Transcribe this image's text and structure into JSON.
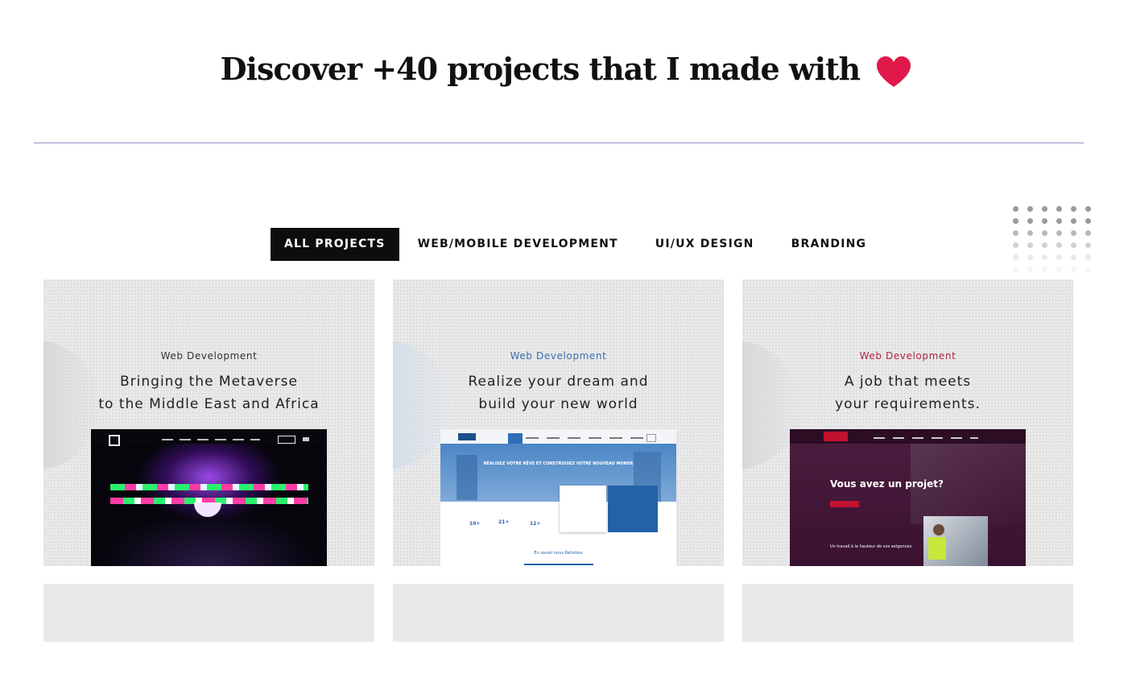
{
  "header": {
    "title": "Discover +40 projects that I made with",
    "heart_icon": "heart-icon",
    "heart_color": "#e0194a"
  },
  "filters": {
    "tabs": [
      {
        "label": "ALL PROJECTS",
        "active": true
      },
      {
        "label": "WEB/MOBILE DEVELOPMENT",
        "active": false
      },
      {
        "label": "UI/UX DESIGN",
        "active": false
      },
      {
        "label": "BRANDING",
        "active": false
      }
    ]
  },
  "projects": [
    {
      "category": "Web Development",
      "category_color": "#333333",
      "title_line1": "Bringing the Metaverse",
      "title_line2": "to the Middle East and Africa"
    },
    {
      "category": "Web Development",
      "category_color": "#3b6db0",
      "title_line1": "Realize your dream and",
      "title_line2": "build your new world",
      "preview": {
        "hero_text": "RÉALISEZ VOTRE RÊVE ET CONSTRUISEZ VOTRE NOUVEAU MONDE",
        "stats": [
          "10+",
          "21+",
          "12+"
        ],
        "link": "En savoir nous Relisions"
      }
    },
    {
      "category": "Web Development",
      "category_color": "#b0253a",
      "title_line1": "A job that meets",
      "title_line2": "your requirements.",
      "preview": {
        "heading": "Vous avez un projet?",
        "subheading": "Un travail à la hauteur de vos exigences."
      }
    }
  ]
}
